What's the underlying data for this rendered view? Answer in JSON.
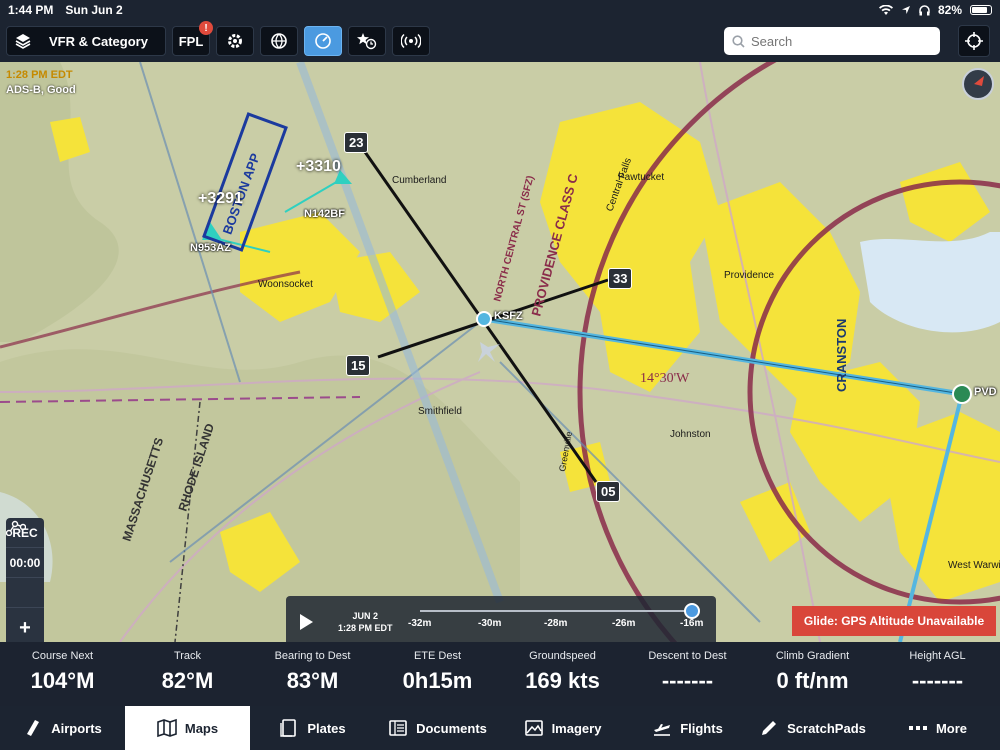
{
  "status_bar": {
    "time": "1:44 PM",
    "date": "Sun Jun 2",
    "battery": "82%"
  },
  "toolbar": {
    "layers_label": "VFR & Category",
    "fpl_label": "FPL",
    "fpl_badge": "!",
    "search_placeholder": "Search"
  },
  "map": {
    "time_label": "1:28 PM EDT",
    "adsb_label": "ADS-B, Good",
    "airport_tag": "KSFZ",
    "pvd_tag": "PVD",
    "runways": {
      "r23": "23",
      "r33": "33",
      "r15": "15",
      "r05": "05"
    },
    "traffic": [
      {
        "alt": "+3310",
        "id": "N142BF"
      },
      {
        "alt": "+3291",
        "id": "N953AZ"
      }
    ],
    "chart_labels": {
      "woonsocket": "Woonsocket",
      "cumberland": "Cumberland",
      "pawtucket": "Pawtucket",
      "central_falls": "Central Falls",
      "providence": "Providence",
      "smithfield": "Smithfield",
      "johnston": "Johnston",
      "greenville": "Greenville",
      "cranston": "CRANSTON",
      "west_warwick": "West Warwick",
      "boston_app": "BOSTON APP",
      "providence_class_c": "PROVIDENCE CLASS C",
      "north_central": "NORTH CENTRAL ST (SFZ)",
      "variation": "14°30'W",
      "massachusetts": "MASSACHUSETTS",
      "rhode_island": "RHODE ISLAND"
    },
    "left_controls": {
      "rec": "REC",
      "timer": "00:00",
      "zoom_in": "+",
      "zoom_out": "−"
    },
    "timeline": {
      "month_day": "JUN 2",
      "time": "1:28 PM EDT",
      "marks": [
        "-32m",
        "-30m",
        "-28m",
        "-26m",
        "-16m"
      ]
    },
    "glide_alert": "Glide: GPS Altitude Unavailable"
  },
  "instruments": [
    {
      "label": "Course Next",
      "value": "104°M"
    },
    {
      "label": "Track",
      "value": "82°M"
    },
    {
      "label": "Bearing to Dest",
      "value": "83°M"
    },
    {
      "label": "ETE Dest",
      "value": "0h15m"
    },
    {
      "label": "Groundspeed",
      "value": "169 kts"
    },
    {
      "label": "Descent to Dest",
      "value": "-------"
    },
    {
      "label": "Climb Gradient",
      "value": "0 ft/nm"
    },
    {
      "label": "Height AGL",
      "value": "-------"
    }
  ],
  "tabs": [
    {
      "label": "Airports",
      "icon": "airports-icon"
    },
    {
      "label": "Maps",
      "icon": "maps-icon"
    },
    {
      "label": "Plates",
      "icon": "plates-icon"
    },
    {
      "label": "Documents",
      "icon": "documents-icon"
    },
    {
      "label": "Imagery",
      "icon": "imagery-icon"
    },
    {
      "label": "Flights",
      "icon": "flights-icon"
    },
    {
      "label": "ScratchPads",
      "icon": "scratchpads-icon"
    },
    {
      "label": "More",
      "icon": "more-icon"
    }
  ],
  "colors": {
    "map_base": "#c9cda6",
    "urban": "#f5e33a",
    "class_c": "#8a2c4a",
    "course_line": "#54b6e0",
    "active_tab": "#ffffff",
    "alert": "#d9463a",
    "toolbar": "#1c2431"
  }
}
